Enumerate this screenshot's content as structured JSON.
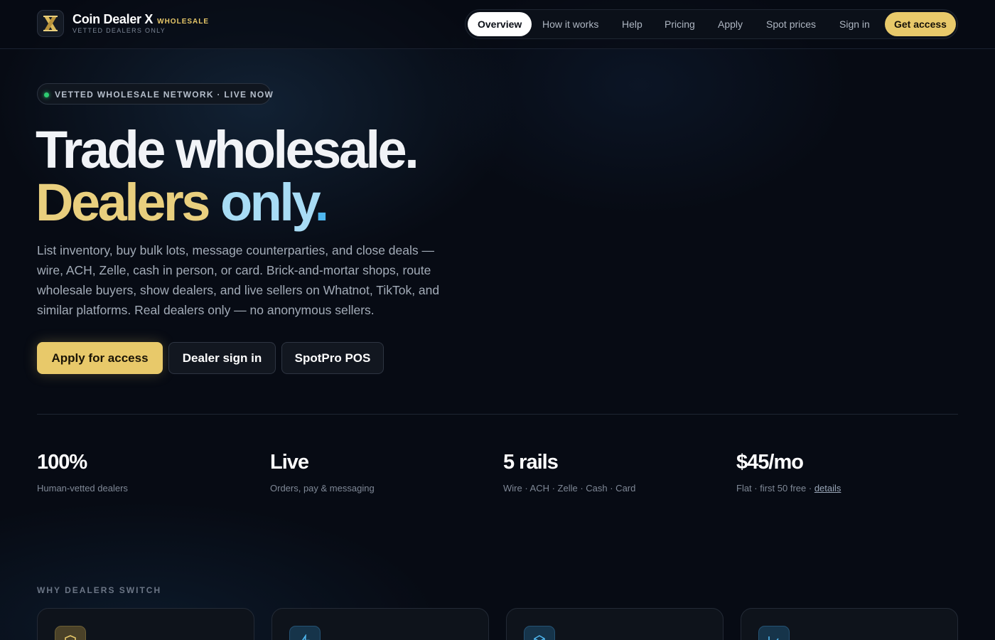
{
  "brand": {
    "name": "Coin Dealer X",
    "tag": "WHOLESALE",
    "subtitle": "VETTED DEALERS ONLY"
  },
  "nav": {
    "items": [
      "Overview",
      "How it works",
      "Help",
      "Pricing",
      "Apply",
      "Spot prices",
      "Sign in"
    ],
    "active": "Overview",
    "cta": "Get access"
  },
  "hero": {
    "pill": "VETTED WHOLESALE NETWORK · LIVE NOW",
    "line1": "Trade wholesale.",
    "line2_gold": "Dealers",
    "line2_blue": "only",
    "line2_dot": ".",
    "description": "List inventory, buy bulk lots, message counterparties, and close deals — wire, ACH, Zelle, cash in person, or card. Brick-and-mortar shops, route wholesale buyers, show dealers, and live sellers on Whatnot, TikTok, and similar platforms. Real dealers only — no anonymous sellers.",
    "buttons": {
      "apply": "Apply for access",
      "signin": "Dealer sign in",
      "pos": "SpotPro POS"
    }
  },
  "stats": [
    {
      "value": "100%",
      "label": "Human-vetted dealers"
    },
    {
      "value": "Live",
      "label": "Orders, pay & messaging"
    },
    {
      "value": "5 rails",
      "label": "Wire · ACH · Zelle · Cash · Card"
    },
    {
      "value": "$45/mo",
      "label": "Flat · first 50 free ·",
      "link": "details"
    }
  ],
  "why": {
    "label": "WHY DEALERS SWITCH",
    "cards": [
      {
        "icon": "shield-icon"
      },
      {
        "icon": "lightning-icon"
      },
      {
        "icon": "cube-icon"
      },
      {
        "icon": "chart-icon"
      }
    ]
  },
  "colors": {
    "accent_gold": "#e8c96a",
    "accent_blue": "#4fb6ee",
    "live_green": "#2ecc71",
    "background": "#070b14"
  }
}
